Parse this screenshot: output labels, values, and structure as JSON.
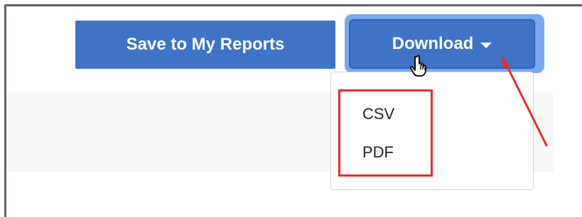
{
  "toolbar": {
    "save_label": "Save to My Reports",
    "download_label": "Download"
  },
  "dropdown": {
    "items": [
      {
        "label": "CSV"
      },
      {
        "label": "PDF"
      }
    ]
  },
  "icons": {
    "caret": "caret-down-icon",
    "pointer": "hand-pointer-icon",
    "annotation_arrow": "red-arrow-icon"
  },
  "colors": {
    "primary_button": "#3e73c6",
    "focus_ring": "#79a8ed",
    "annotation_red": "#ec2b2b",
    "menu_border": "#d3d3d3",
    "window_border": "#5d6168",
    "panel_bg": "#f7f7f7"
  }
}
